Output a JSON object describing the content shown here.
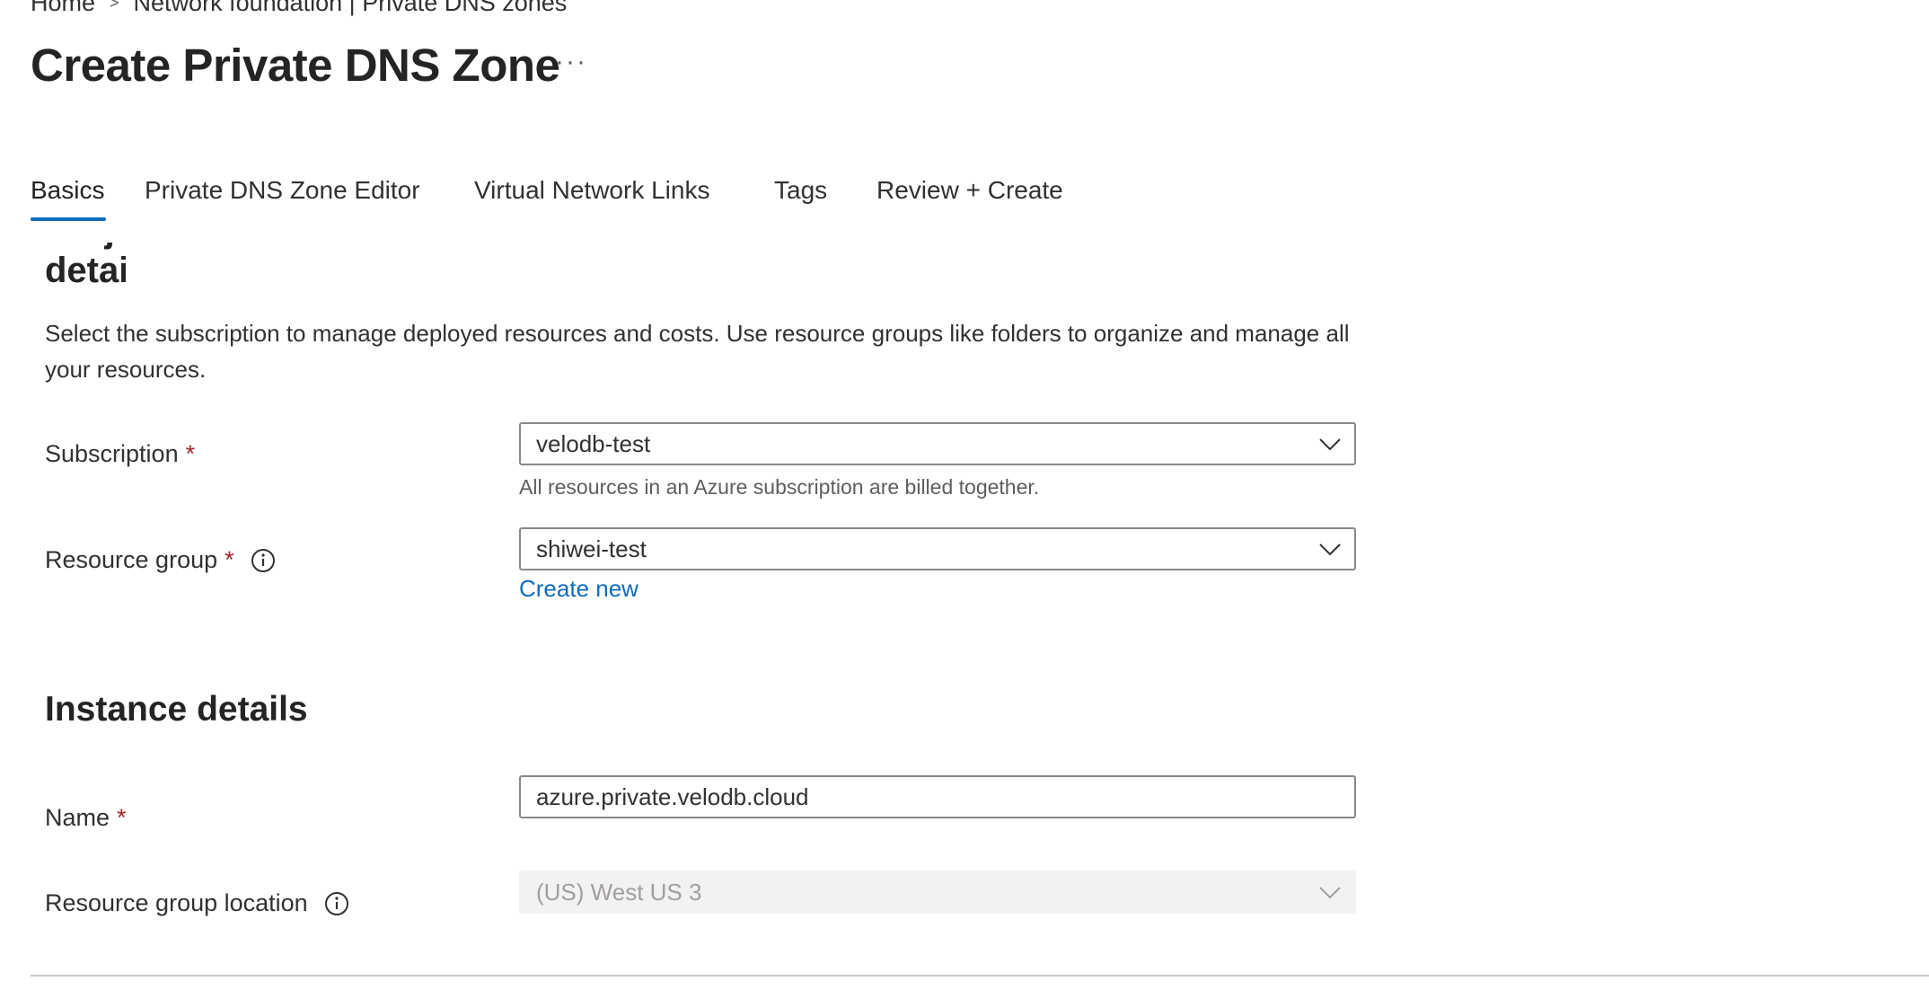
{
  "breadcrumb": {
    "home": "Home",
    "separator": ">",
    "parent": "Network foundation | Private DNS zones"
  },
  "page": {
    "title": "Create Private DNS Zone",
    "more_label": "···"
  },
  "tabs": [
    {
      "label": "Basics",
      "active": true
    },
    {
      "label": "Private DNS Zone Editor",
      "active": false
    },
    {
      "label": "Virtual Network Links",
      "active": false
    },
    {
      "label": "Tags",
      "active": false
    },
    {
      "label": "Review + Create",
      "active": false
    }
  ],
  "project_details": {
    "heading_fragment": "Project details",
    "description": "Select the subscription to manage deployed resources and costs. Use resource groups like folders to organize and manage all your resources.",
    "subscription": {
      "label": "Subscription",
      "required_mark": "*",
      "value": "velodb-test",
      "helper": "All resources in an Azure subscription are billed together."
    },
    "resource_group": {
      "label": "Resource group",
      "required_mark": "*",
      "value": "shiwei-test",
      "create_new": "Create new"
    }
  },
  "instance_details": {
    "heading": "Instance details",
    "name": {
      "label": "Name",
      "required_mark": "*",
      "value": "azure.private.velodb.cloud"
    },
    "location": {
      "label": "Resource group location",
      "value": "(US) West US 3",
      "disabled": true
    }
  },
  "colors": {
    "accent": "#0f6cbd",
    "required": "#a4262c",
    "text": "#323130",
    "disabled_bg": "#f3f2f1"
  }
}
